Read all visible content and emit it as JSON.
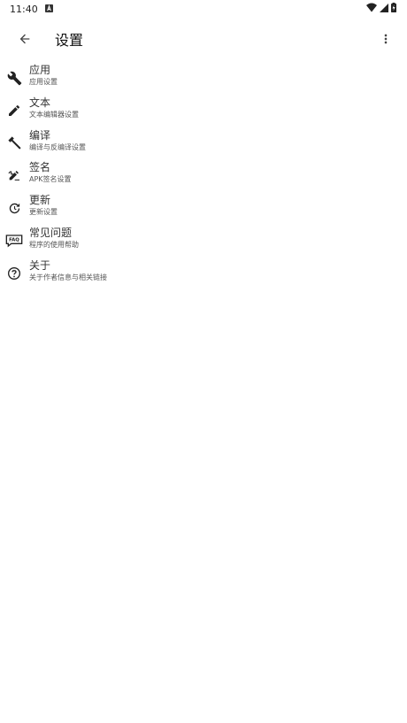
{
  "status": {
    "time": "11:40",
    "notif_icon": "a-notification-icon"
  },
  "appbar": {
    "title": "设置"
  },
  "items": [
    {
      "title": "应用",
      "subtitle": "应用设置",
      "icon": "wrench-icon"
    },
    {
      "title": "文本",
      "subtitle": "文本编辑器设置",
      "icon": "pencil-icon"
    },
    {
      "title": "编译",
      "subtitle": "编译与反编译设置",
      "icon": "hammer-icon"
    },
    {
      "title": "签名",
      "subtitle": "APK签名设置",
      "icon": "signature-icon"
    },
    {
      "title": "更新",
      "subtitle": "更新设置",
      "icon": "update-icon"
    },
    {
      "title": "常见问题",
      "subtitle": "程序的使用帮助",
      "icon": "faq-icon"
    },
    {
      "title": "关于",
      "subtitle": "关于作者信息与相关链接",
      "icon": "help-circle-icon"
    }
  ]
}
